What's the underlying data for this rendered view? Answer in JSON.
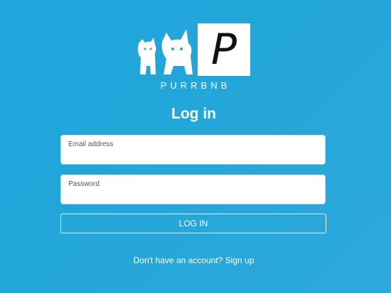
{
  "brand": {
    "wordmark": "PURRBNB",
    "logo_letter": "P",
    "logo_icon": "cats-icon"
  },
  "login": {
    "title": "Log in",
    "email_label": "Email address",
    "email_value": "",
    "password_label": "Password",
    "password_value": "",
    "submit_label": "LOG IN"
  },
  "footer": {
    "prompt": "Don't have an account?",
    "signup_link": "Sign up"
  },
  "colors": {
    "background": "#23a6da",
    "text": "#ffffff",
    "field_background": "#ffffff"
  }
}
